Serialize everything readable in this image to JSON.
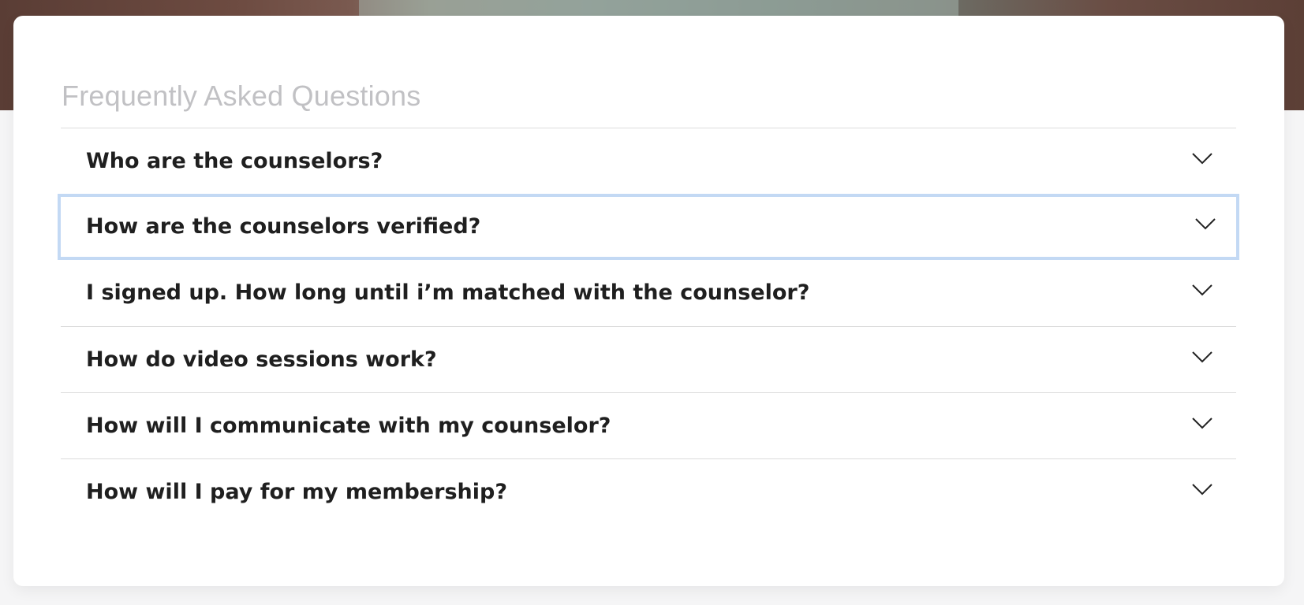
{
  "faq": {
    "title": "Frequently Asked Questions",
    "items": [
      {
        "question": "Who are the counselors?",
        "icon": "chevron-down-icon",
        "focused": false
      },
      {
        "question": "How are the counselors verified?",
        "icon": "chevron-down-icon",
        "focused": true
      },
      {
        "question": "I signed up. How long until i’m matched with the counselor?",
        "icon": "chevron-down-icon",
        "focused": false
      },
      {
        "question": "How do video sessions work?",
        "icon": "chevron-down-icon",
        "focused": false
      },
      {
        "question": "How will I communicate with my counselor?",
        "icon": "chevron-down-icon",
        "focused": false
      },
      {
        "question": "How will I pay for my membership?",
        "icon": "chevron-down-icon",
        "focused": false
      }
    ]
  },
  "colors": {
    "title": "#c1c1c4",
    "question_text": "#1f1f1f",
    "divider": "#dcdcdc",
    "focus_ring": "#c3d9f4",
    "card_background": "#ffffff",
    "page_background": "#f5f5f6"
  }
}
